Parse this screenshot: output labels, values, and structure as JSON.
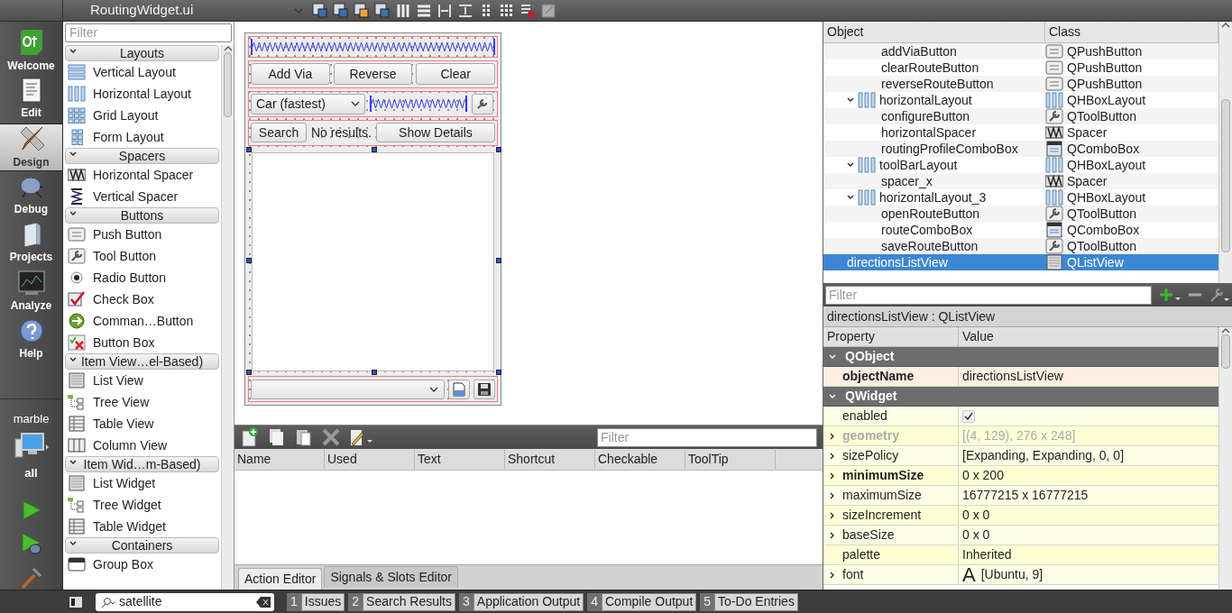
{
  "editor": {
    "file_name": "RoutingWidget.ui"
  },
  "modes": [
    {
      "label": "Welcome",
      "kind": "welcome",
      "selected": false
    },
    {
      "label": "Edit",
      "kind": "edit",
      "selected": false
    },
    {
      "label": "Design",
      "kind": "design",
      "selected": true
    },
    {
      "label": "Debug",
      "kind": "debug",
      "selected": false
    },
    {
      "label": "Projects",
      "kind": "projects",
      "selected": false
    },
    {
      "label": "Analyze",
      "kind": "analyze",
      "selected": false
    },
    {
      "label": "Help",
      "kind": "help",
      "selected": false
    }
  ],
  "kit": {
    "project": "marble",
    "build": "all"
  },
  "widget_box": {
    "filter_placeholder": "Filter",
    "categories": [
      {
        "title": "Layouts",
        "expanded": true,
        "items": [
          {
            "label": "Vertical Layout",
            "kind": "vbox"
          },
          {
            "label": "Horizontal Layout",
            "kind": "hbox"
          },
          {
            "label": "Grid Layout",
            "kind": "grid"
          },
          {
            "label": "Form Layout",
            "kind": "form"
          }
        ]
      },
      {
        "title": "Spacers",
        "expanded": true,
        "items": [
          {
            "label": "Horizontal Spacer",
            "kind": "hspacer"
          },
          {
            "label": "Vertical Spacer",
            "kind": "vspacer"
          }
        ]
      },
      {
        "title": "Buttons",
        "expanded": true,
        "items": [
          {
            "label": "Push Button",
            "kind": "push"
          },
          {
            "label": "Tool Button",
            "kind": "tool"
          },
          {
            "label": "Radio Button",
            "kind": "radio"
          },
          {
            "label": "Check Box",
            "kind": "check"
          },
          {
            "label": "Comman…Button",
            "kind": "command"
          },
          {
            "label": "Button Box",
            "kind": "buttonbox"
          }
        ]
      },
      {
        "title": "Item View…el-Based)",
        "expanded": true,
        "items": [
          {
            "label": "List View",
            "kind": "list"
          },
          {
            "label": "Tree View",
            "kind": "tree"
          },
          {
            "label": "Table View",
            "kind": "table"
          },
          {
            "label": "Column View",
            "kind": "column"
          }
        ]
      },
      {
        "title": "Item Wid…m-Based)",
        "expanded": true,
        "items": [
          {
            "label": "List Widget",
            "kind": "list"
          },
          {
            "label": "Tree Widget",
            "kind": "tree"
          },
          {
            "label": "Table Widget",
            "kind": "table"
          }
        ]
      },
      {
        "title": "Containers",
        "expanded": true,
        "items": [
          {
            "label": "Group Box",
            "kind": "groupbox"
          }
        ]
      }
    ]
  },
  "form": {
    "route_buttons": [
      "Add Via",
      "Reverse",
      "Clear"
    ],
    "profile_combo": "Car (fastest)",
    "search_button": "Search",
    "status_label": "No results.",
    "details_button": "Show Details"
  },
  "action_editor": {
    "filter_placeholder": "Filter",
    "columns": [
      "Name",
      "Used",
      "Text",
      "Shortcut",
      "Checkable",
      "ToolTip"
    ],
    "tabs": [
      {
        "label": "Action Editor",
        "selected": true
      },
      {
        "label": "Signals & Slots Editor",
        "selected": false
      }
    ]
  },
  "object_inspector": {
    "columns": [
      "Object",
      "Class"
    ],
    "tree": [
      {
        "children": [
          {
            "object": "addViaButton",
            "class": "QPushButton",
            "kind": "push",
            "selected": false
          },
          {
            "object": "clearRouteButton",
            "class": "QPushButton",
            "kind": "push",
            "selected": false
          },
          {
            "object": "reverseRouteButton",
            "class": "QPushButton",
            "kind": "push",
            "selected": false
          }
        ]
      },
      {
        "object": "horizontalLayout",
        "class": "QHBoxLayout",
        "kind": "layout",
        "selected": false,
        "expanded": true,
        "children": [
          {
            "object": "configureButton",
            "class": "QToolButton",
            "kind": "tool",
            "selected": false
          },
          {
            "object": "horizontalSpacer",
            "class": "Spacer",
            "kind": "spacer",
            "selected": false
          },
          {
            "object": "routingProfileComboBox",
            "class": "QComboBox",
            "kind": "combo",
            "selected": false
          }
        ]
      },
      {
        "object": "toolBarLayout",
        "class": "QHBoxLayout",
        "kind": "layout",
        "selected": false,
        "expanded": true,
        "children": [
          {
            "object": "spacer_x",
            "class": "Spacer",
            "kind": "spacer",
            "selected": false
          }
        ]
      },
      {
        "object": "horizontalLayout_3",
        "class": "QHBoxLayout",
        "kind": "layout",
        "selected": false,
        "expanded": true,
        "children": [
          {
            "object": "openRouteButton",
            "class": "QToolButton",
            "kind": "tool",
            "selected": false
          },
          {
            "object": "routeComboBox",
            "class": "QComboBox",
            "kind": "combo",
            "selected": false
          },
          {
            "object": "saveRouteButton",
            "class": "QToolButton",
            "kind": "tool",
            "selected": false
          }
        ]
      },
      {
        "object": "directionsListView",
        "class": "QListView",
        "kind": "listview",
        "selected": true
      }
    ]
  },
  "property_editor": {
    "filter_placeholder": "Filter",
    "title": "directionsListView : QListView",
    "columns": [
      "Property",
      "Value"
    ],
    "groups": [
      {
        "name": "QObject",
        "expanded": true,
        "properties": [
          {
            "name": "objectName",
            "value": "directionsListView",
            "expandable": false,
            "changed": true,
            "disabled": false
          }
        ]
      },
      {
        "name": "QWidget",
        "expanded": true,
        "properties": [
          {
            "name": "enabled",
            "kind": "checkbox",
            "checked": true,
            "expandable": false,
            "changed": false,
            "disabled": false
          },
          {
            "name": "geometry",
            "value": "[(4, 129), 276 x 248]",
            "expandable": true,
            "changed": false,
            "disabled": true
          },
          {
            "name": "sizePolicy",
            "value": "[Expanding, Expanding, 0, 0]",
            "expandable": true,
            "changed": false,
            "disabled": false
          },
          {
            "name": "minimumSize",
            "value": "0 x 200",
            "expandable": true,
            "changed": true,
            "disabled": false
          },
          {
            "name": "maximumSize",
            "value": "16777215 x 16777215",
            "expandable": true,
            "changed": false,
            "disabled": false
          },
          {
            "name": "sizeIncrement",
            "value": "0 x 0",
            "expandable": true,
            "changed": false,
            "disabled": false
          },
          {
            "name": "baseSize",
            "value": "0 x 0",
            "expandable": true,
            "changed": false,
            "disabled": false
          },
          {
            "name": "palette",
            "value": "Inherited",
            "expandable": false,
            "changed": false,
            "disabled": false
          },
          {
            "name": "font",
            "kind": "font",
            "preview": "A",
            "value": "[Ubuntu, 9]",
            "expandable": true,
            "changed": false,
            "disabled": false
          }
        ]
      }
    ]
  },
  "status_bar": {
    "search": "satellite",
    "panes": [
      {
        "number": "1",
        "label": "Issues"
      },
      {
        "number": "2",
        "label": "Search Results"
      },
      {
        "number": "3",
        "label": "Application Output"
      },
      {
        "number": "4",
        "label": "Compile Output"
      },
      {
        "number": "5",
        "label": "To-Do Entries"
      }
    ]
  }
}
